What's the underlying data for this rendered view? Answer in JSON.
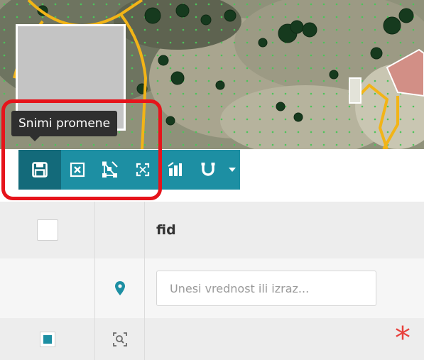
{
  "tooltip": {
    "text": "Snimi promene"
  },
  "toolbar": {
    "buttons": [
      {
        "name": "save-icon",
        "title": "Snimi promene",
        "active": true
      },
      {
        "name": "close-x-icon"
      },
      {
        "name": "vertex-edit-icon"
      },
      {
        "name": "zoom-extent-icon"
      },
      {
        "name": "chart-icon"
      },
      {
        "name": "magnet-icon"
      },
      {
        "name": "caret-down-icon"
      }
    ],
    "accent_color": "#1d8fa3",
    "active_color": "#136a7a"
  },
  "highlight_color": "#e6141b",
  "table": {
    "columns": [
      {
        "label": "fid"
      }
    ],
    "filter": {
      "placeholder": "Unesi vrednost ili izraz...",
      "value": ""
    },
    "icons": {
      "filter_row": "location-pin-icon",
      "data_row": "zoom-to-feature-icon"
    },
    "new_row_marker": "*"
  }
}
